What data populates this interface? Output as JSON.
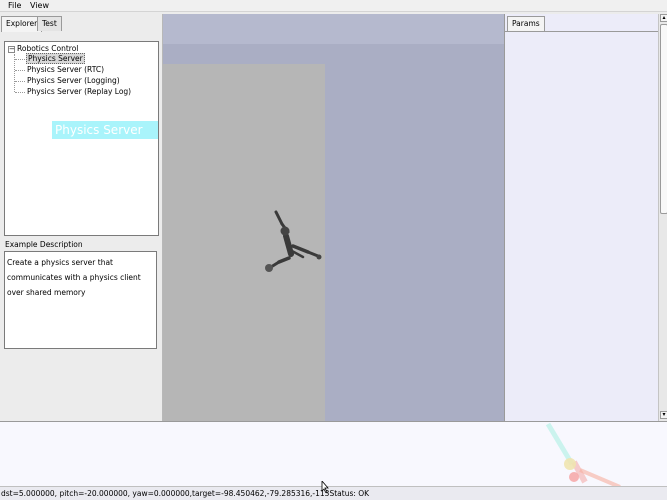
{
  "menubar": {
    "items": [
      "File",
      "View"
    ]
  },
  "left_panel": {
    "tabs": [
      "Explorer",
      "Test"
    ],
    "tree": {
      "root": "Robotics Control",
      "children": [
        "Physics Server",
        "Physics Server (RTC)",
        "Physics Server (Logging)",
        "Physics Server (Replay Log)"
      ]
    },
    "drag_label": "Physics Server",
    "description_label": "Example Description",
    "description_lines": [
      "Create a physics server that",
      "communicates with a physics client",
      "over shared memory"
    ]
  },
  "params_panel": {
    "tab": "Params"
  },
  "statusbar": {
    "camera": "dst=5.000000, pitch=-20.000000, yaw=0.000000,target=-98.450462,-79.285316,-113",
    "status": "Status: OK"
  },
  "colors": {
    "viewport_bg": "#aaaec4",
    "floor": "#b6b6b6",
    "drag_label_bg": "#8cf0fa"
  }
}
